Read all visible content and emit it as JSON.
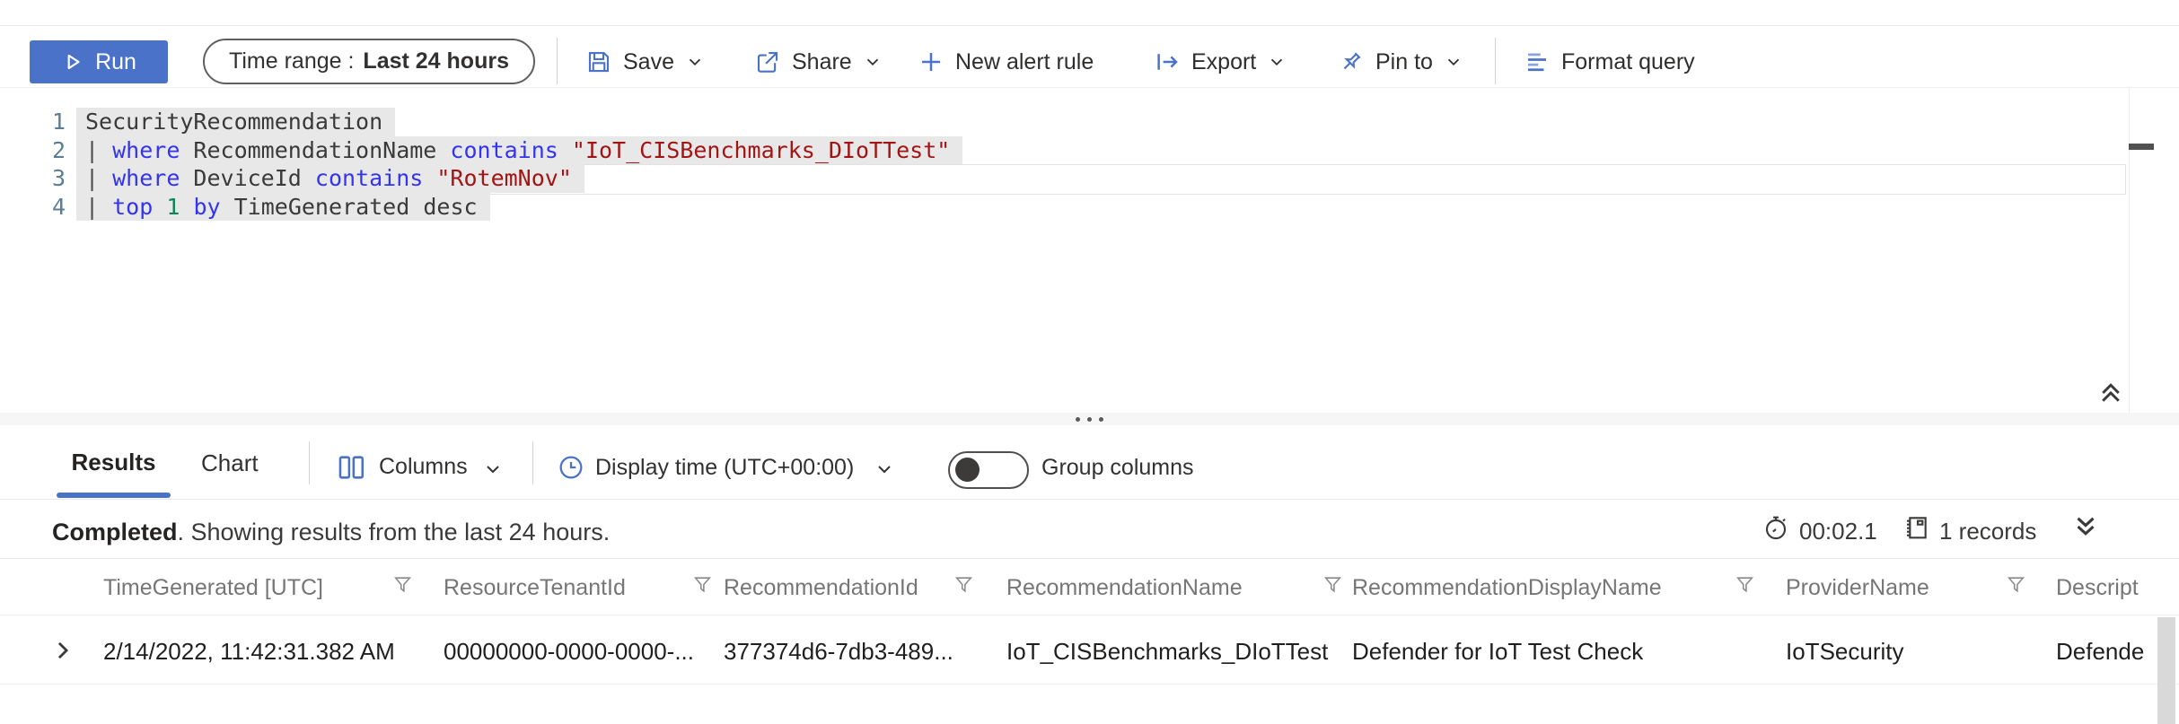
{
  "toolbar": {
    "run_label": "Run",
    "time_range_label": "Time range :",
    "time_range_value": "Last 24 hours",
    "save_label": "Save",
    "share_label": "Share",
    "new_alert_rule_label": "New alert rule",
    "export_label": "Export",
    "pin_to_label": "Pin to",
    "format_query_label": "Format query"
  },
  "editor": {
    "line_numbers": [
      "1",
      "2",
      "3",
      "4"
    ],
    "line1": {
      "table_name": "SecurityRecommendation"
    },
    "line2": {
      "pipe": "| ",
      "kw_where": "where",
      "field": " RecommendationName ",
      "kw_contains": "contains",
      "space": " ",
      "value": "\"IoT_CISBenchmarks_DIoTTest\""
    },
    "line3": {
      "pipe": "| ",
      "kw_where": "where",
      "field": " DeviceId ",
      "kw_contains": "contains",
      "space": " ",
      "value": "\"RotemNov\""
    },
    "line4": {
      "pipe": "| ",
      "kw_top": "top",
      "sp1": " ",
      "count": "1",
      "sp2": " ",
      "kw_by": "by",
      "field": " TimeGenerated ",
      "order": "desc"
    }
  },
  "results_panel": {
    "results_tab": "Results",
    "chart_tab": "Chart",
    "columns_label": "Columns",
    "display_time_label": "Display time (UTC+00:00)",
    "group_columns_label": "Group columns"
  },
  "status_bar": {
    "completed_label": "Completed",
    "completed_message": ". Showing results from the last 24 hours.",
    "elapsed_time": "00:02.1",
    "record_count": "1 records"
  },
  "table": {
    "headers": [
      "TimeGenerated [UTC]",
      "ResourceTenantId",
      "RecommendationId",
      "RecommendationName",
      "RecommendationDisplayName",
      "ProviderName",
      "Descript"
    ],
    "row": [
      "2/14/2022, 11:42:31.382 AM",
      "00000000-0000-0000-...",
      "377374d6-7db3-489...",
      "IoT_CISBenchmarks_DIoTTest",
      "Defender for IoT Test Check",
      "IoTSecurity",
      "Defende"
    ]
  },
  "colors": {
    "accent_blue": "#4a72c8",
    "keyword_blue": "#3434f0",
    "string_red": "#a31515",
    "number_green": "#098658",
    "line_number_blue": "#5b7e93",
    "selection_gray": "#e8e8e8"
  }
}
